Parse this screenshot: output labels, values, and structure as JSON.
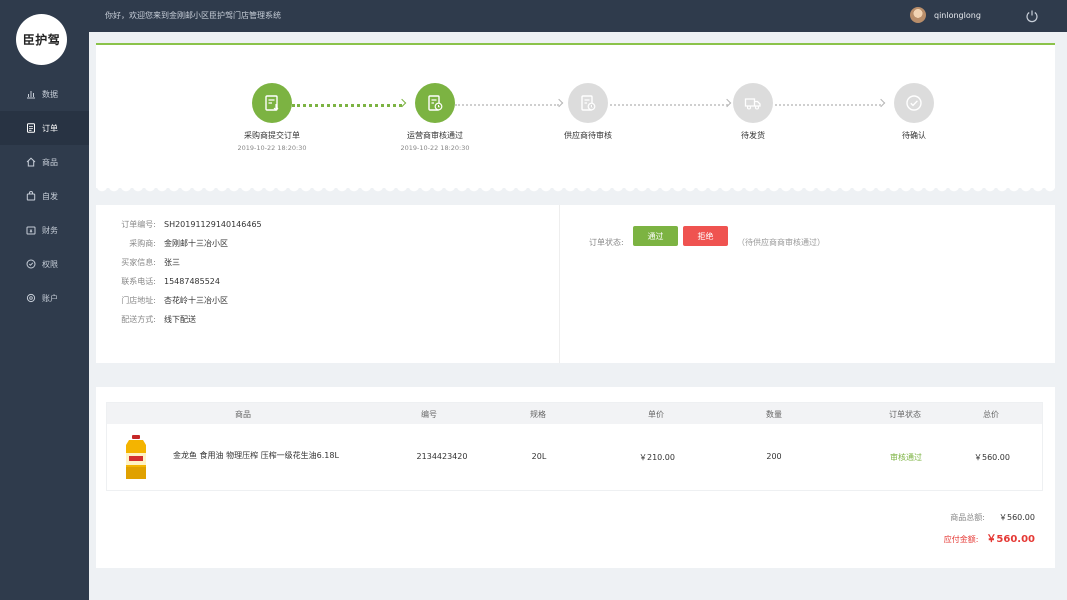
{
  "app": {
    "logo_text": "臣护驾",
    "welcome": "你好，欢迎您来到金刚邮小区臣护驾门店管理系统",
    "username": "qinlonglong"
  },
  "sidebar": {
    "items": [
      {
        "label": "数据",
        "icon": "bar-chart-icon",
        "active": false
      },
      {
        "label": "订单",
        "icon": "document-icon",
        "active": true
      },
      {
        "label": "商品",
        "icon": "home-icon",
        "active": false
      },
      {
        "label": "自发",
        "icon": "bag-icon",
        "active": false
      },
      {
        "label": "财务",
        "icon": "wallet-icon",
        "active": false
      },
      {
        "label": "权限",
        "icon": "shield-icon",
        "active": false
      },
      {
        "label": "账户",
        "icon": "gear-icon",
        "active": false
      }
    ]
  },
  "steps": [
    {
      "label": "采购商提交订单",
      "time": "2019-10-22 18:20:30",
      "done": true
    },
    {
      "label": "运营商审核通过",
      "time": "2019-10-22 18:20:30",
      "done": true
    },
    {
      "label": "供应商待审核",
      "time": "",
      "done": false
    },
    {
      "label": "待发货",
      "time": "",
      "done": false
    },
    {
      "label": "待确认",
      "time": "",
      "done": false
    }
  ],
  "order": {
    "fields": [
      {
        "key": "订单编号:",
        "value": "SH20191129140146465"
      },
      {
        "key": "采购商:",
        "value": "金刚邮十三冶小区"
      },
      {
        "key": "买家信息:",
        "value": "张三"
      },
      {
        "key": "联系电话:",
        "value": "15487485524"
      },
      {
        "key": "门店地址:",
        "value": "杏花岭十三冶小区"
      },
      {
        "key": "配送方式:",
        "value": "线下配送"
      }
    ],
    "status_label": "订单状态:",
    "pass_label": "通过",
    "reject_label": "拒绝",
    "status_note": "（待供应商商审核通过）"
  },
  "table": {
    "headers": [
      "商品",
      "编号",
      "规格",
      "单价",
      "数量",
      "订单状态",
      "总价"
    ],
    "rows": [
      {
        "name": "金龙鱼 食用油 物理压榨 压榨一级花生油6.18L",
        "code": "2134423420",
        "spec": "20L",
        "price": "￥210.00",
        "qty": "200",
        "status": "审核通过",
        "total": "￥560.00"
      }
    ]
  },
  "summary": {
    "goods_total_label": "商品总额:",
    "goods_total": "￥560.00",
    "pay_label": "应付金额:",
    "pay_total": "￥560.00"
  },
  "colors": {
    "sidebar_bg": "#2f3b4c",
    "accent_green": "#7cb342",
    "danger_red": "#ef5350"
  }
}
